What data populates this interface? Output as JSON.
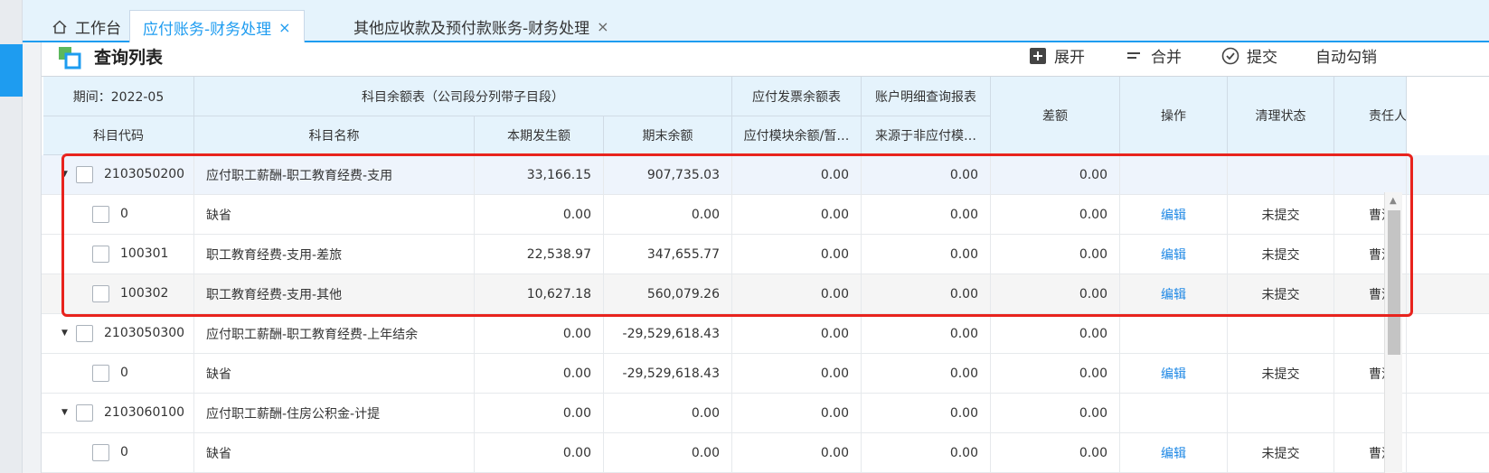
{
  "tabs": [
    {
      "label": "工作台",
      "icon": "home-icon"
    },
    {
      "label": "应付账务-财务处理",
      "close": "×"
    },
    {
      "label": "其他应收款及预付款账务-财务处理",
      "close": "×"
    }
  ],
  "panel": {
    "title": "查询列表",
    "toolbar": {
      "expand": "展开",
      "merge": "合并",
      "submit": "提交",
      "auto_writeoff": "自动勾销"
    }
  },
  "table": {
    "header": {
      "period": "期间：2022-05",
      "subject_balance_group": "科目余额表（公司段分列带子目段）",
      "ap_invoice_group": "应付发票余额表",
      "account_detail_group": "账户明细查询报表",
      "code": "科目代码",
      "name": "科目名称",
      "current": "本期发生额",
      "ending": "期末余额",
      "ap_module": "应付模块余额/暂…",
      "non_ap_source": "来源于非应付模…",
      "diff": "差额",
      "action": "操作",
      "status": "清理状态",
      "owner": "责任人"
    },
    "rows": [
      {
        "level": 0,
        "code": "2103050200",
        "name": "应付职工薪酬-职工教育经费-支用",
        "current": "33,166.15",
        "ending": "907,735.03",
        "ap": "0.00",
        "non_ap": "0.00",
        "diff": "0.00",
        "action": "",
        "status": "",
        "owner": ""
      },
      {
        "level": 1,
        "code": "0",
        "name": "缺省",
        "current": "0.00",
        "ending": "0.00",
        "ap": "0.00",
        "non_ap": "0.00",
        "diff": "0.00",
        "action": "编辑",
        "status": "未提交",
        "owner": "曹洁"
      },
      {
        "level": 1,
        "code": "100301",
        "name": "职工教育经费-支用-差旅",
        "current": "22,538.97",
        "ending": "347,655.77",
        "ap": "0.00",
        "non_ap": "0.00",
        "diff": "0.00",
        "action": "编辑",
        "status": "未提交",
        "owner": "曹洁"
      },
      {
        "level": 1,
        "code": "100302",
        "name": "职工教育经费-支用-其他",
        "current": "10,627.18",
        "ending": "560,079.26",
        "ap": "0.00",
        "non_ap": "0.00",
        "diff": "0.00",
        "action": "编辑",
        "status": "未提交",
        "owner": "曹洁"
      },
      {
        "level": 0,
        "code": "2103050300",
        "name": "应付职工薪酬-职工教育经费-上年结余",
        "current": "0.00",
        "ending": "-29,529,618.43",
        "ap": "0.00",
        "non_ap": "0.00",
        "diff": "0.00",
        "action": "",
        "status": "",
        "owner": ""
      },
      {
        "level": 1,
        "code": "0",
        "name": "缺省",
        "current": "0.00",
        "ending": "-29,529,618.43",
        "ap": "0.00",
        "non_ap": "0.00",
        "diff": "0.00",
        "action": "编辑",
        "status": "未提交",
        "owner": "曹洁"
      },
      {
        "level": 0,
        "code": "2103060100",
        "name": "应付职工薪酬-住房公积金-计提",
        "current": "0.00",
        "ending": "0.00",
        "ap": "0.00",
        "non_ap": "0.00",
        "diff": "0.00",
        "action": "",
        "status": "",
        "owner": ""
      },
      {
        "level": 1,
        "code": "0",
        "name": "缺省",
        "current": "0.00",
        "ending": "0.00",
        "ap": "0.00",
        "non_ap": "0.00",
        "diff": "0.00",
        "action": "编辑",
        "status": "未提交",
        "owner": "曹洁"
      }
    ]
  },
  "colors": {
    "accent": "#1e9cf0",
    "header_bg": "#e5f3fc",
    "highlight": "#e8231d",
    "link": "#1e88e5"
  }
}
